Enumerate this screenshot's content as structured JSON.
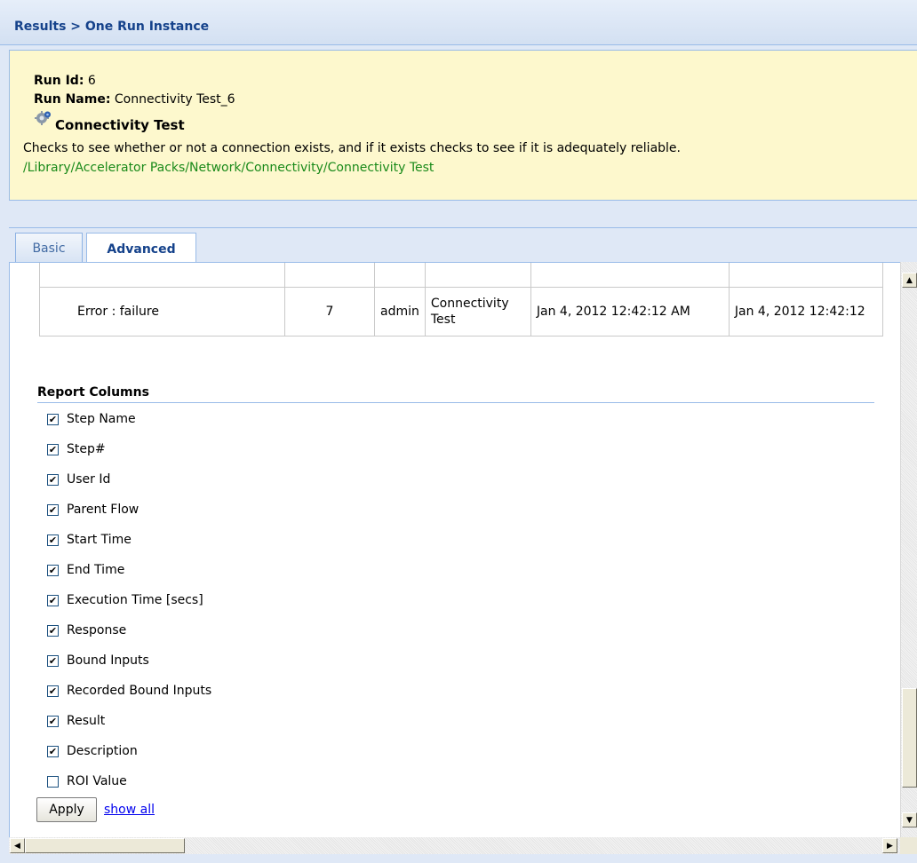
{
  "header": {
    "title": "Results > One Run Instance"
  },
  "run_info": {
    "run_id_label": "Run Id:",
    "run_id_value": "6",
    "run_name_label": "Run Name:",
    "run_name_value": "Connectivity Test_6",
    "flow_icon": "gear-icon",
    "flow_name": "Connectivity Test",
    "flow_description": "Checks to see whether or not a connection exists, and if it exists checks to see if it is adequately reliable.",
    "flow_path": "/Library/Accelerator Packs/Network/Connectivity/Connectivity Test"
  },
  "tabs": [
    {
      "label": "Basic",
      "active": false
    },
    {
      "label": "Advanced",
      "active": true
    }
  ],
  "results_table": {
    "rows": [
      {
        "step_name": "Error : failure",
        "step_num": "7",
        "user_id": "admin",
        "parent_flow": "Connectivity Test",
        "start_time": "Jan 4, 2012 12:42:12 AM",
        "end_time": "Jan 4, 2012 12:42:12"
      }
    ]
  },
  "report_columns": {
    "title": "Report Columns",
    "items": [
      {
        "label": "Step Name",
        "checked": true
      },
      {
        "label": "Step#",
        "checked": true
      },
      {
        "label": "User Id",
        "checked": true
      },
      {
        "label": "Parent Flow",
        "checked": true
      },
      {
        "label": "Start Time",
        "checked": true
      },
      {
        "label": "End Time",
        "checked": true
      },
      {
        "label": "Execution Time [secs]",
        "checked": true
      },
      {
        "label": "Response",
        "checked": true
      },
      {
        "label": "Bound Inputs",
        "checked": true
      },
      {
        "label": "Recorded Bound Inputs",
        "checked": true
      },
      {
        "label": "Result",
        "checked": true
      },
      {
        "label": "Description",
        "checked": true
      },
      {
        "label": "ROI Value",
        "checked": false
      }
    ],
    "apply_label": "Apply",
    "show_all_label": "show all"
  }
}
